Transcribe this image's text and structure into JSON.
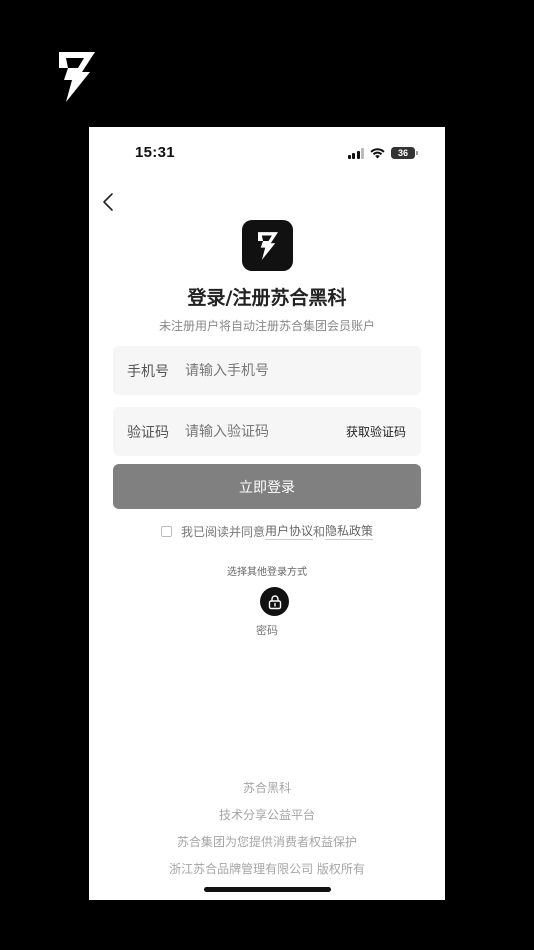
{
  "status_bar": {
    "time": "15:31",
    "battery": "36"
  },
  "title": "登录/注册苏合黑科",
  "subtitle": "未注册用户将自动注册苏合集团会员账户",
  "phone_field": {
    "label": "手机号",
    "placeholder": "请输入手机号"
  },
  "code_field": {
    "label": "验证码",
    "placeholder": "请输入验证码",
    "get_code": "获取验证码"
  },
  "login_button": "立即登录",
  "agreement": {
    "prefix": "我已阅读并同意",
    "user_agreement": "用户协议",
    "and": "和",
    "privacy_policy": "隐私政策"
  },
  "other_login": {
    "title": "选择其他登录方式",
    "password_label": "密码"
  },
  "footer": [
    "苏合黑科",
    "技术分享公益平台",
    "苏合集团为您提供消费者权益保护",
    "浙江苏合品牌管理有限公司 版权所有"
  ],
  "colors": {
    "login_button": "#808080",
    "logo_bg": "#111111",
    "field_bg": "#f6f6f6"
  },
  "icons": {
    "logo": "lightning-bolt-icon",
    "back": "chevron-left-icon",
    "password": "lock-icon"
  }
}
